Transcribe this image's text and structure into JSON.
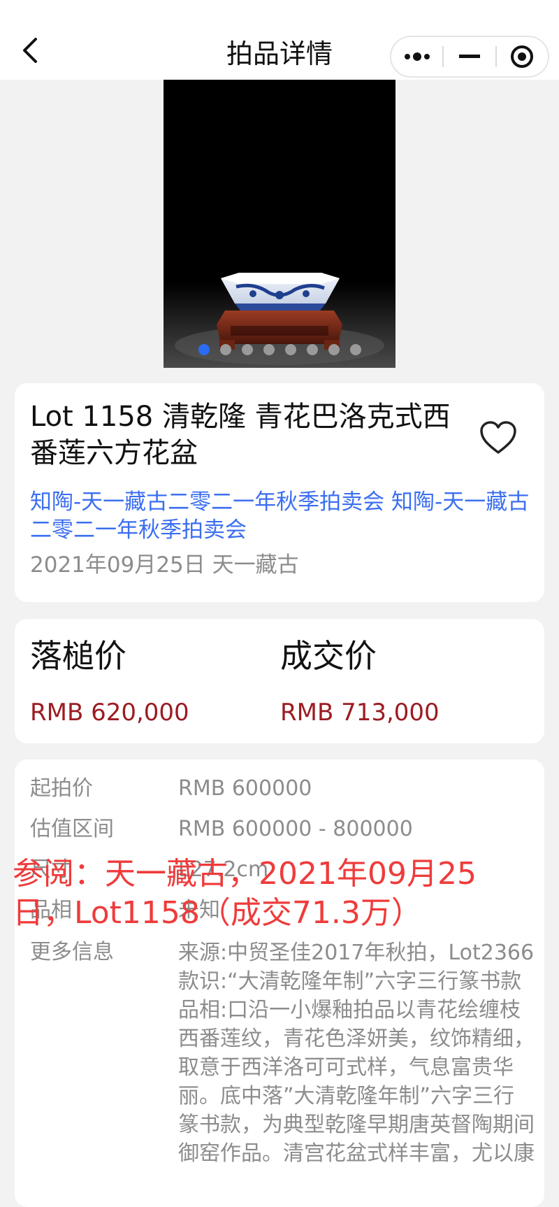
{
  "nav": {
    "title": "拍品详情",
    "back_icon": "chevron-left-icon",
    "capsule_icons": [
      "more-dots-icon",
      "minimize-icon",
      "record-target-icon"
    ]
  },
  "gallery": {
    "image_subject": "blue-and-white-hexagonal-flowerpot-on-wooden-stand",
    "slide_count": 8,
    "active_index": 0,
    "active_color": "#2b6cf6"
  },
  "lot": {
    "title": "Lot 1158 清乾隆 青花巴洛克式西番莲六方花盆",
    "auction_link": "知陶-天一藏古二零二一年秋季拍卖会 知陶-天一藏古二零二一年秋季拍卖会",
    "date_house": "2021年09月25日 天一藏古",
    "favorite_icon": "heart-outline-icon"
  },
  "prices": {
    "hammer_label": "落槌价",
    "hammer_value": "RMB 620,000",
    "final_label": "成交价",
    "final_value": "RMB 713,000",
    "value_color": "#9b1c22"
  },
  "info": {
    "start_label": "起拍价",
    "start_value": "RMB 600000",
    "estimate_label": "估值区间",
    "estimate_value": "RMB 600000 - 800000",
    "size_label": "尺寸",
    "size_value": "L27.2cm",
    "condition_label": "品相",
    "condition_value": "未知",
    "more_label": "更多信息",
    "more_value": "来源:中贸圣佳2017年秋拍，Lot2366款识:“大清乾隆年制”六字三行篆书款品相:口沿一小爆釉拍品以青花绘缠枝西番莲纹，青花色泽妍美，纹饰精细，取意于西洋洛可可式样，气息富贵华丽。底中落”大清乾隆年制”六字三行篆书款，为典型乾隆早期唐英督陶期间御窑作品。清宫花盆式样丰富，尤以康"
  },
  "overlay": {
    "note": "参阅：天一藏古，2021年09月25日，Lot1158（成交71.3万）",
    "color": "#ef3b3b"
  }
}
